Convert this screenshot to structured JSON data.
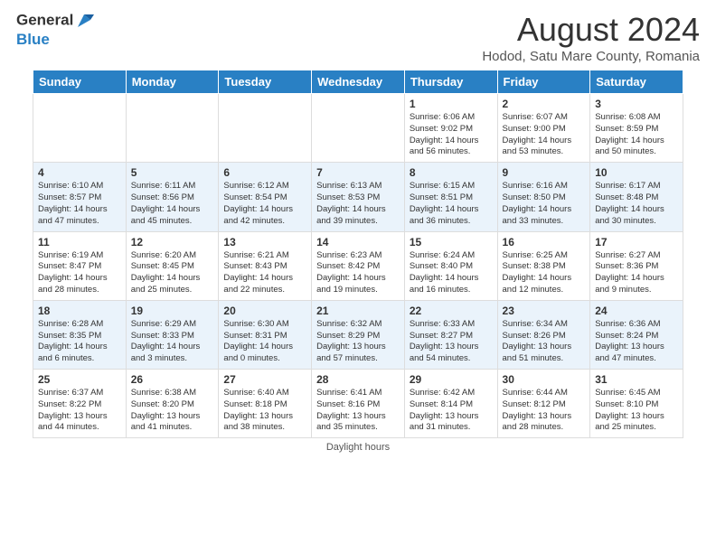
{
  "header": {
    "logo_line1": "General",
    "logo_line2": "Blue",
    "main_title": "August 2024",
    "sub_title": "Hodod, Satu Mare County, Romania"
  },
  "days_of_week": [
    "Sunday",
    "Monday",
    "Tuesday",
    "Wednesday",
    "Thursday",
    "Friday",
    "Saturday"
  ],
  "weeks": [
    [
      {
        "day": "",
        "info": ""
      },
      {
        "day": "",
        "info": ""
      },
      {
        "day": "",
        "info": ""
      },
      {
        "day": "",
        "info": ""
      },
      {
        "day": "1",
        "info": "Sunrise: 6:06 AM\nSunset: 9:02 PM\nDaylight: 14 hours\nand 56 minutes."
      },
      {
        "day": "2",
        "info": "Sunrise: 6:07 AM\nSunset: 9:00 PM\nDaylight: 14 hours\nand 53 minutes."
      },
      {
        "day": "3",
        "info": "Sunrise: 6:08 AM\nSunset: 8:59 PM\nDaylight: 14 hours\nand 50 minutes."
      }
    ],
    [
      {
        "day": "4",
        "info": "Sunrise: 6:10 AM\nSunset: 8:57 PM\nDaylight: 14 hours\nand 47 minutes."
      },
      {
        "day": "5",
        "info": "Sunrise: 6:11 AM\nSunset: 8:56 PM\nDaylight: 14 hours\nand 45 minutes."
      },
      {
        "day": "6",
        "info": "Sunrise: 6:12 AM\nSunset: 8:54 PM\nDaylight: 14 hours\nand 42 minutes."
      },
      {
        "day": "7",
        "info": "Sunrise: 6:13 AM\nSunset: 8:53 PM\nDaylight: 14 hours\nand 39 minutes."
      },
      {
        "day": "8",
        "info": "Sunrise: 6:15 AM\nSunset: 8:51 PM\nDaylight: 14 hours\nand 36 minutes."
      },
      {
        "day": "9",
        "info": "Sunrise: 6:16 AM\nSunset: 8:50 PM\nDaylight: 14 hours\nand 33 minutes."
      },
      {
        "day": "10",
        "info": "Sunrise: 6:17 AM\nSunset: 8:48 PM\nDaylight: 14 hours\nand 30 minutes."
      }
    ],
    [
      {
        "day": "11",
        "info": "Sunrise: 6:19 AM\nSunset: 8:47 PM\nDaylight: 14 hours\nand 28 minutes."
      },
      {
        "day": "12",
        "info": "Sunrise: 6:20 AM\nSunset: 8:45 PM\nDaylight: 14 hours\nand 25 minutes."
      },
      {
        "day": "13",
        "info": "Sunrise: 6:21 AM\nSunset: 8:43 PM\nDaylight: 14 hours\nand 22 minutes."
      },
      {
        "day": "14",
        "info": "Sunrise: 6:23 AM\nSunset: 8:42 PM\nDaylight: 14 hours\nand 19 minutes."
      },
      {
        "day": "15",
        "info": "Sunrise: 6:24 AM\nSunset: 8:40 PM\nDaylight: 14 hours\nand 16 minutes."
      },
      {
        "day": "16",
        "info": "Sunrise: 6:25 AM\nSunset: 8:38 PM\nDaylight: 14 hours\nand 12 minutes."
      },
      {
        "day": "17",
        "info": "Sunrise: 6:27 AM\nSunset: 8:36 PM\nDaylight: 14 hours\nand 9 minutes."
      }
    ],
    [
      {
        "day": "18",
        "info": "Sunrise: 6:28 AM\nSunset: 8:35 PM\nDaylight: 14 hours\nand 6 minutes."
      },
      {
        "day": "19",
        "info": "Sunrise: 6:29 AM\nSunset: 8:33 PM\nDaylight: 14 hours\nand 3 minutes."
      },
      {
        "day": "20",
        "info": "Sunrise: 6:30 AM\nSunset: 8:31 PM\nDaylight: 14 hours\nand 0 minutes."
      },
      {
        "day": "21",
        "info": "Sunrise: 6:32 AM\nSunset: 8:29 PM\nDaylight: 13 hours\nand 57 minutes."
      },
      {
        "day": "22",
        "info": "Sunrise: 6:33 AM\nSunset: 8:27 PM\nDaylight: 13 hours\nand 54 minutes."
      },
      {
        "day": "23",
        "info": "Sunrise: 6:34 AM\nSunset: 8:26 PM\nDaylight: 13 hours\nand 51 minutes."
      },
      {
        "day": "24",
        "info": "Sunrise: 6:36 AM\nSunset: 8:24 PM\nDaylight: 13 hours\nand 47 minutes."
      }
    ],
    [
      {
        "day": "25",
        "info": "Sunrise: 6:37 AM\nSunset: 8:22 PM\nDaylight: 13 hours\nand 44 minutes."
      },
      {
        "day": "26",
        "info": "Sunrise: 6:38 AM\nSunset: 8:20 PM\nDaylight: 13 hours\nand 41 minutes."
      },
      {
        "day": "27",
        "info": "Sunrise: 6:40 AM\nSunset: 8:18 PM\nDaylight: 13 hours\nand 38 minutes."
      },
      {
        "day": "28",
        "info": "Sunrise: 6:41 AM\nSunset: 8:16 PM\nDaylight: 13 hours\nand 35 minutes."
      },
      {
        "day": "29",
        "info": "Sunrise: 6:42 AM\nSunset: 8:14 PM\nDaylight: 13 hours\nand 31 minutes."
      },
      {
        "day": "30",
        "info": "Sunrise: 6:44 AM\nSunset: 8:12 PM\nDaylight: 13 hours\nand 28 minutes."
      },
      {
        "day": "31",
        "info": "Sunrise: 6:45 AM\nSunset: 8:10 PM\nDaylight: 13 hours\nand 25 minutes."
      }
    ]
  ],
  "footer": {
    "note": "Daylight hours"
  }
}
